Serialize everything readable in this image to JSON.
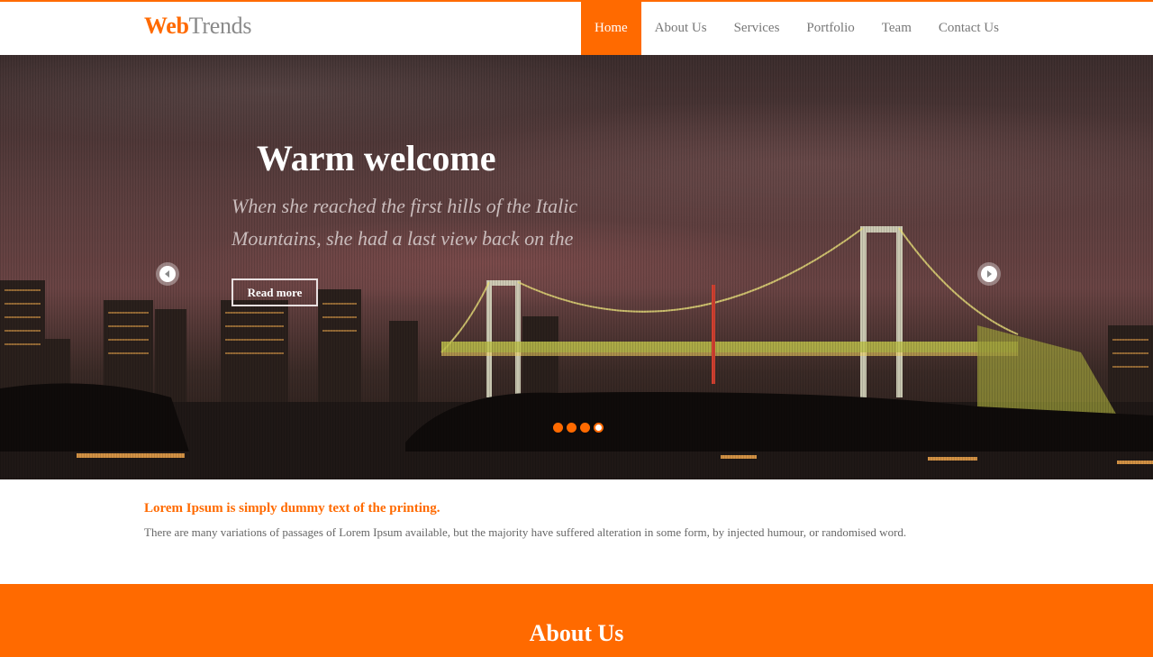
{
  "brand": {
    "part1": "Web",
    "part2": "Trends"
  },
  "nav": {
    "items": [
      {
        "label": "Home",
        "active": true
      },
      {
        "label": "About Us"
      },
      {
        "label": "Services"
      },
      {
        "label": "Portfolio"
      },
      {
        "label": "Team"
      },
      {
        "label": "Contact Us"
      }
    ]
  },
  "hero": {
    "title": "Warm welcome",
    "subtitle_line1": "When she reached the first hills of the Italic",
    "subtitle_line2": "Mountains, she had a last view back on the",
    "button_label": "Read more",
    "slide_count": 4,
    "active_slide": 4,
    "prev_icon": "chevron-left-icon",
    "next_icon": "chevron-right-icon"
  },
  "intro": {
    "title": "Lorem Ipsum is simply dummy text of the printing.",
    "text": "There are many variations of passages of Lorem Ipsum available, but the majority have suffered alteration in some form, by injected humour, or randomised word."
  },
  "about": {
    "title": "About Us"
  },
  "colors": {
    "accent": "#ff6a00",
    "nav_text": "#777777",
    "body_text": "#666666"
  }
}
